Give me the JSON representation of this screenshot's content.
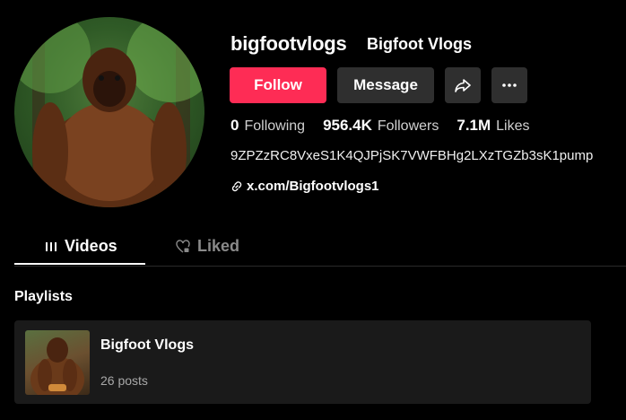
{
  "profile": {
    "username": "bigfootvlogs",
    "display_name": "Bigfoot Vlogs",
    "bio": "9ZPZzRC8VxeS1K4QJPjSK7VWFBHg2LXzTGZb3sK1pump",
    "link_text": "x.com/Bigfootvlogs1"
  },
  "actions": {
    "follow_label": "Follow",
    "message_label": "Message",
    "share_icon": "share-icon",
    "more_icon": "more-icon"
  },
  "stats": {
    "following_count": "0",
    "following_label": "Following",
    "followers_count": "956.4K",
    "followers_label": "Followers",
    "likes_count": "7.1M",
    "likes_label": "Likes"
  },
  "tabs": [
    {
      "label": "Videos",
      "icon": "grid-icon",
      "active": true
    },
    {
      "label": "Liked",
      "icon": "heart-lock-icon",
      "active": false
    }
  ],
  "playlists": {
    "section_title": "Playlists",
    "items": [
      {
        "title": "Bigfoot Vlogs",
        "count": "26 posts"
      }
    ]
  },
  "colors": {
    "background": "#000000",
    "accent": "#fe2c55",
    "button_secondary": "#2f2f2f",
    "card": "#1a1a1a"
  }
}
